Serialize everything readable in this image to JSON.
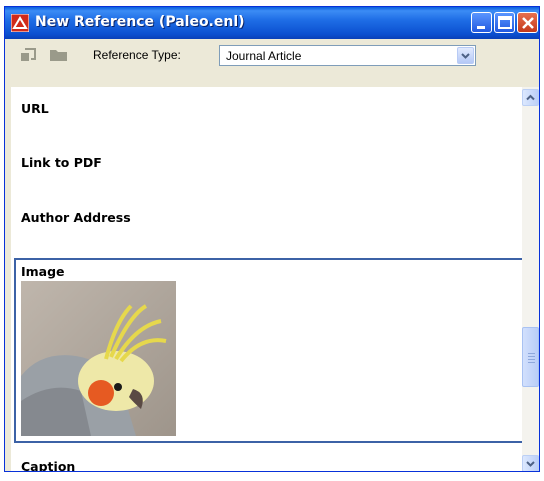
{
  "window": {
    "title": "New Reference (Paleo.enl)",
    "controls": [
      "minimize-icon",
      "maximize-icon",
      "close-icon"
    ]
  },
  "toolbar": {
    "icons": [
      "go-back-icon",
      "folder-icon"
    ],
    "reference_type_label": "Reference Type:",
    "reference_type_value": "Journal Article"
  },
  "fields": {
    "url": "URL",
    "link_to_pdf": "Link to PDF",
    "author_address": "Author Address",
    "image": "Image",
    "caption": "Caption"
  },
  "image_field": {
    "content": "cockatiel-photo"
  },
  "colors": {
    "titlebar": "#0a5fde",
    "field_focus_border": "#3c62a6",
    "chrome": "#ece9d8"
  }
}
